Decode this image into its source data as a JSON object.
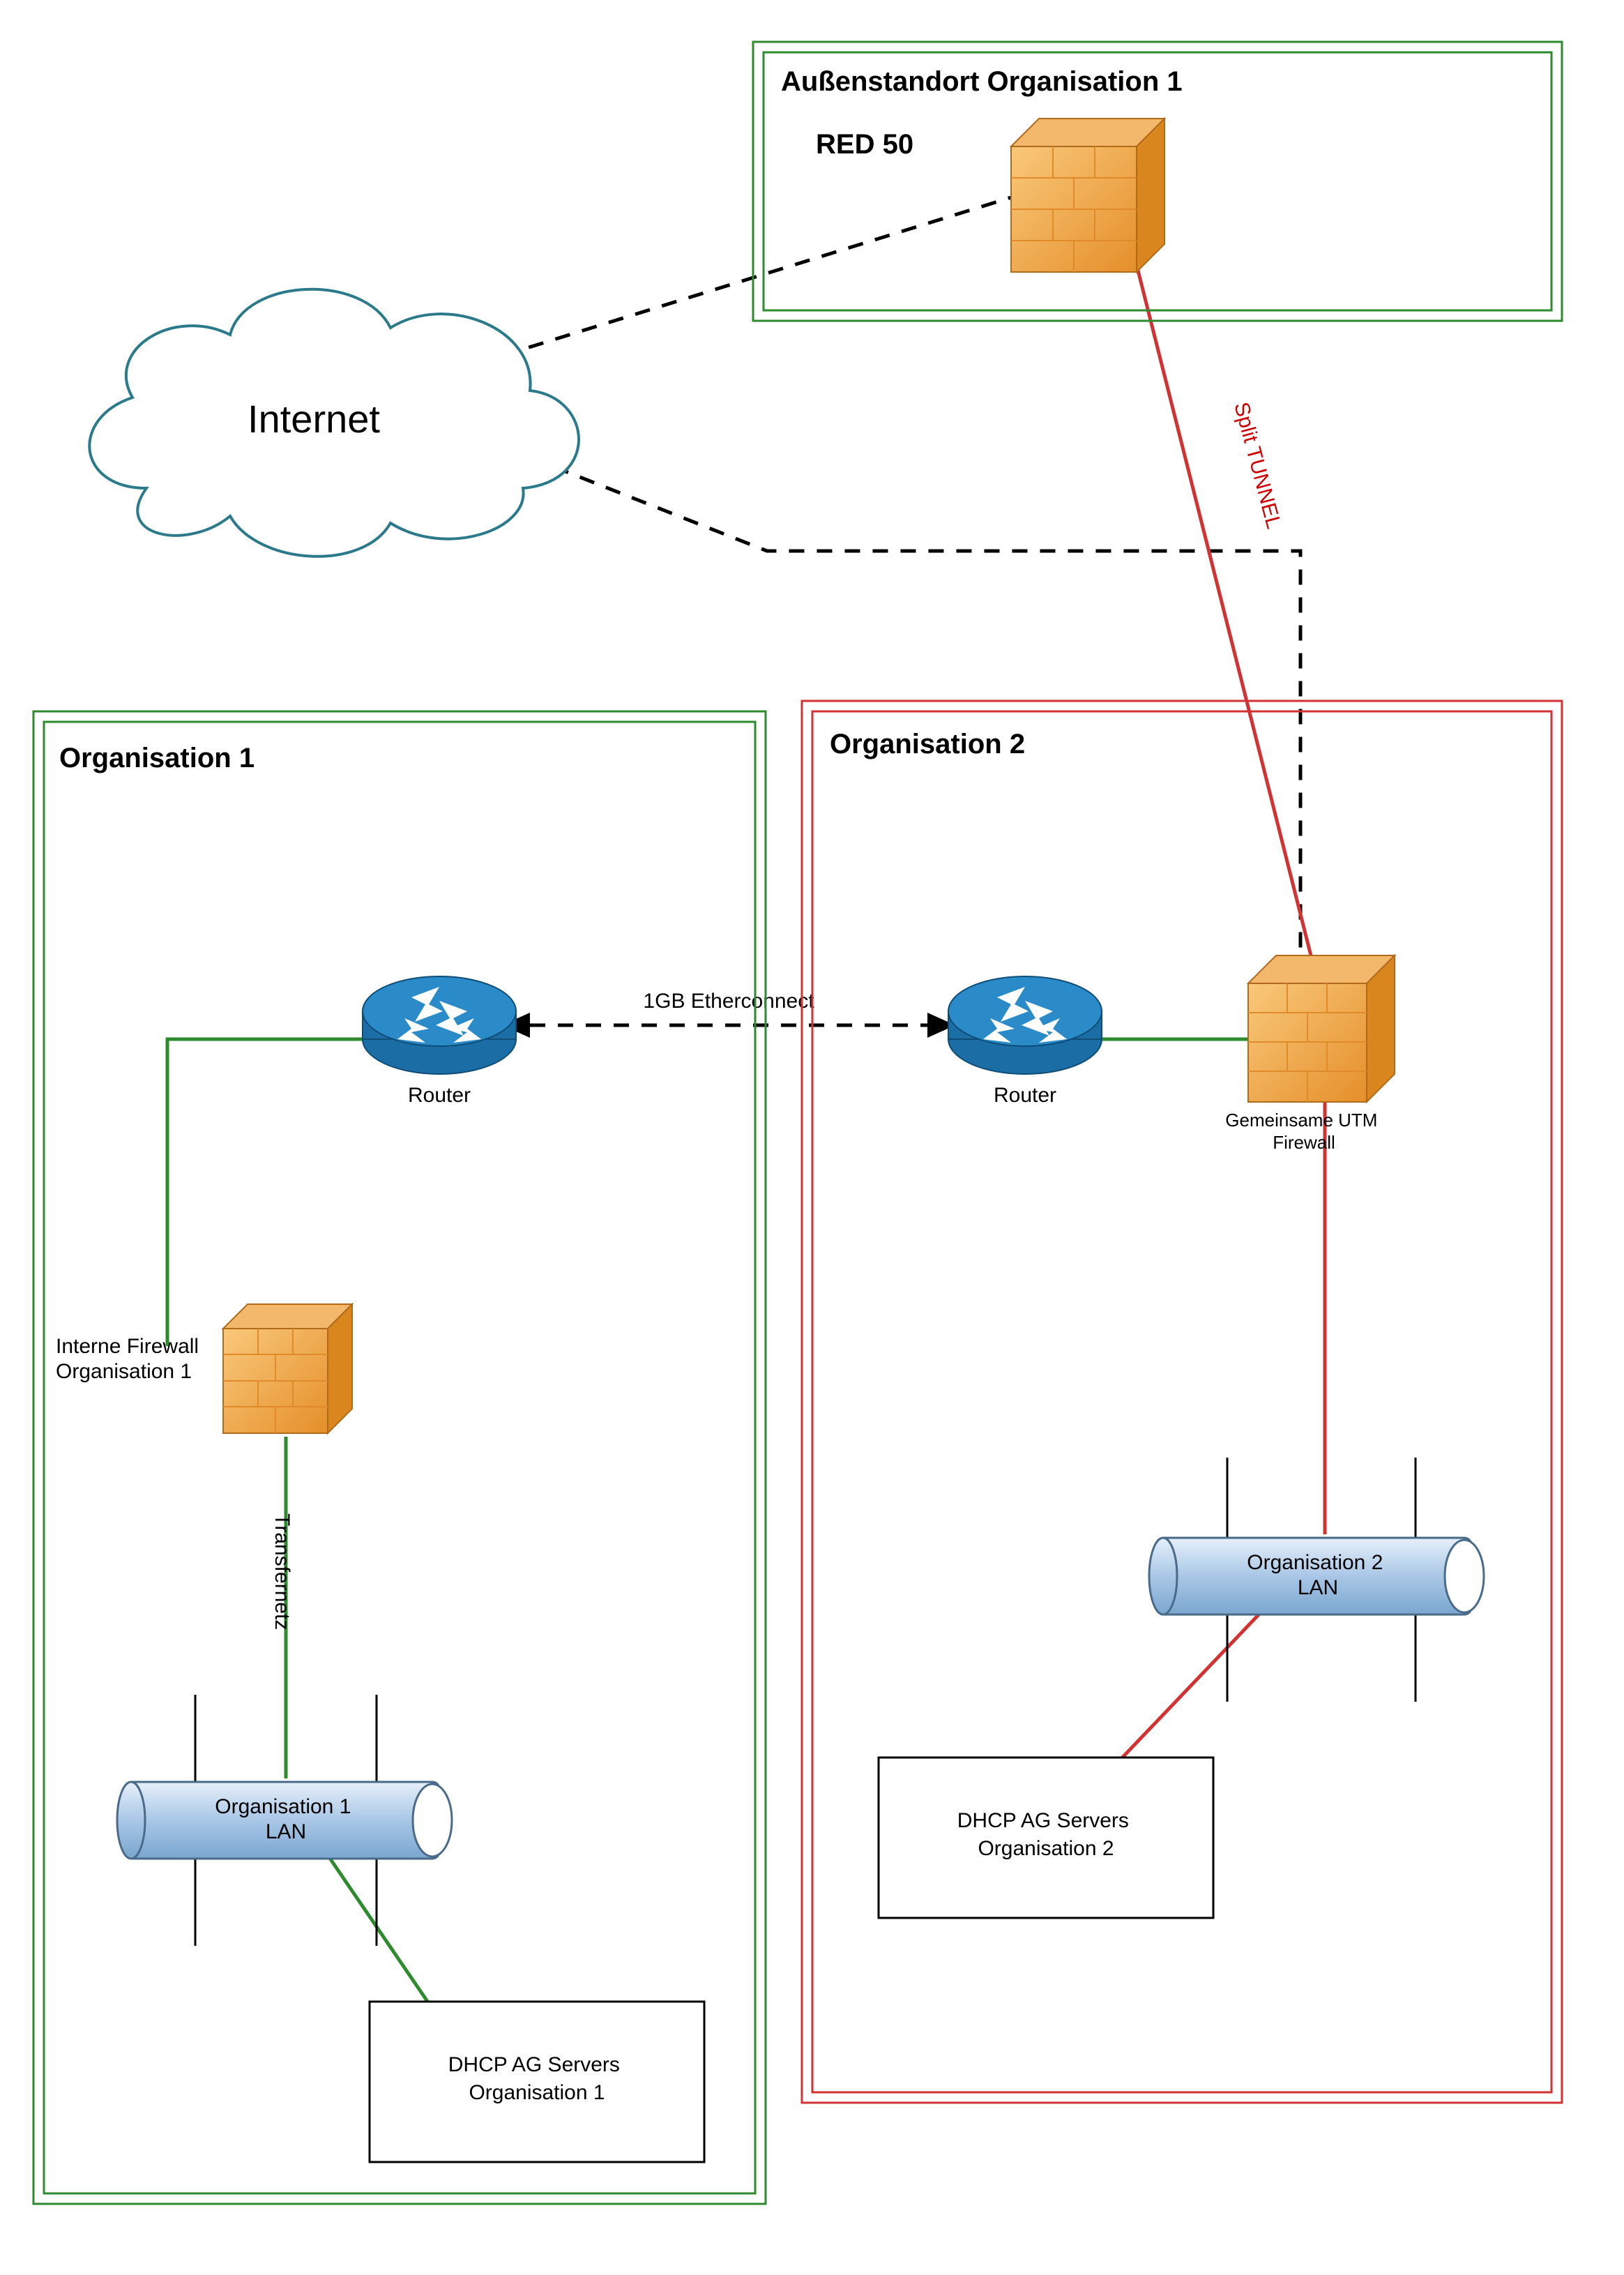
{
  "diagram": {
    "cloud_label": "Internet",
    "ethernet_label": "1GB Etherconnect",
    "split_tunnel_label": "Split TUNNEL",
    "transfer_label": "Transfernetz",
    "org1_remote": {
      "title": "Außenstandort Organisation 1",
      "device": "RED 50"
    },
    "org1": {
      "title": "Organisation 1",
      "router": "Router",
      "firewall": "Interne Firewall\nOrganisation 1",
      "lan": "Organisation 1\nLAN",
      "servers": "DHCP AG Servers\nOrganisation 1"
    },
    "org2": {
      "title": "Organisation 2",
      "router": "Router",
      "utm": "Gemeinsame UTM\nFirewall",
      "lan": "Organisation 2\nLAN",
      "servers": "DHCP AG Servers\nOrganisation 2"
    }
  }
}
